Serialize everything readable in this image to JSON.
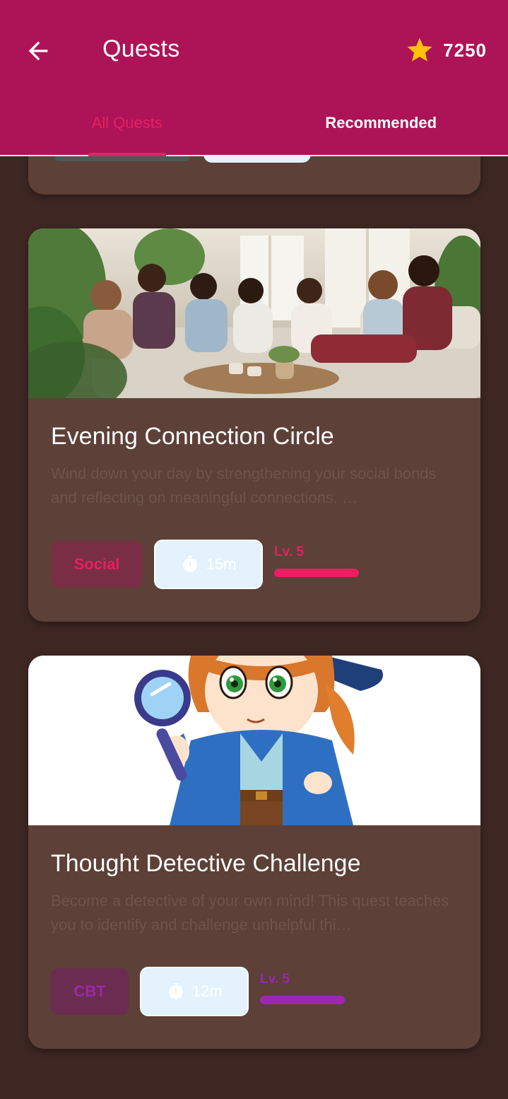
{
  "header": {
    "title": "Quests",
    "points": "7250",
    "accent_color": "#ad1457",
    "star_color": "#ffc107"
  },
  "tabs": [
    {
      "label": "All Quests",
      "active": true
    },
    {
      "label": "Recommended",
      "active": false
    }
  ],
  "quests": [
    {
      "title": "Evening Connection Circle",
      "description": "Wind down your day by strengthening your social bonds and reflecting on meaningful connections. …",
      "category": "Social",
      "category_color": "#e91e63",
      "duration": "15m",
      "level": "Lv. 5",
      "level_color": "#e91e63",
      "image": "group-of-women-on-couch-illustration"
    },
    {
      "title": "Thought Detective Challenge",
      "description": "Become a detective of your own mind! This quest teaches you to identify and challenge unhelpful thi…",
      "category": "CBT",
      "category_color": "#9c27b0",
      "duration": "12m",
      "level": "Lv. 5",
      "level_color": "#9c27b0",
      "image": "cartoon-detective-girl-with-magnifying-glass"
    }
  ]
}
